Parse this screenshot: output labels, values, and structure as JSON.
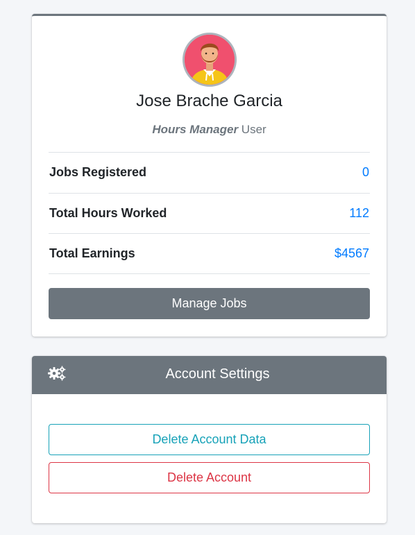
{
  "profile": {
    "avatar_icon": "user-avatar-bearded-man",
    "name": "Jose Brache Garcia",
    "role_strong": "Hours Manager",
    "role_suffix": " User"
  },
  "stats": [
    {
      "label": "Jobs Registered",
      "value": "0"
    },
    {
      "label": "Total Hours Worked",
      "value": "112"
    },
    {
      "label": "Total Earnings",
      "value": "$4567"
    }
  ],
  "actions": {
    "manage_jobs_label": "Manage Jobs"
  },
  "settings": {
    "icon": "cogs-icon",
    "title": "Account Settings",
    "delete_data_label": "Delete Account Data",
    "delete_account_label": "Delete Account"
  },
  "colors": {
    "secondary": "#6c757d",
    "link_blue": "#007bff",
    "info": "#17a2b8",
    "danger": "#dc3545",
    "avatar_bg": "#f0506e"
  }
}
